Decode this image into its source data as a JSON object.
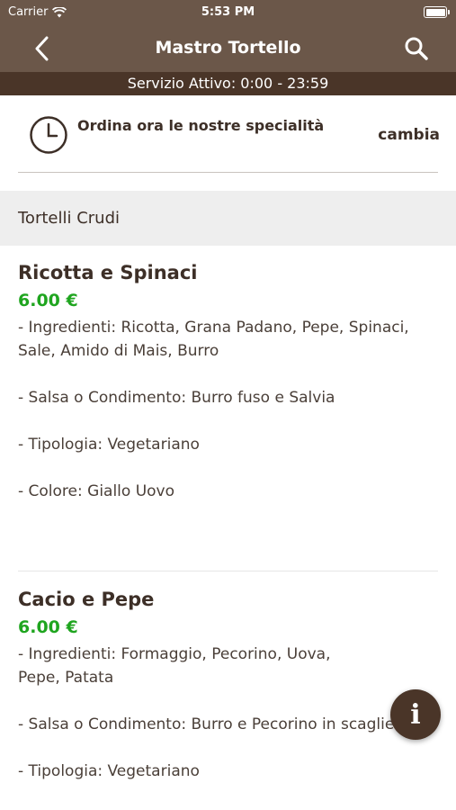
{
  "status_bar": {
    "carrier": "Carrier",
    "time": "5:53 PM"
  },
  "nav": {
    "title": "Mastro Tortello",
    "back_icon": "chevron-left-icon",
    "search_icon": "search-icon"
  },
  "service": {
    "text": "Servizio Attivo: 0:00 - 23:59"
  },
  "order": {
    "icon": "clock-icon",
    "text": "Ordina ora le nostre specialità",
    "change_label": "cambia"
  },
  "category": {
    "name": "Tortelli Crudi"
  },
  "products": [
    {
      "name": "Ricotta e Spinaci",
      "price": "6.00 €",
      "ingredients": "- Ingredienti: Ricotta, Grana Padano, Pepe, Spinaci, Sale, Amido di Mais, Burro",
      "sauce": "- Salsa o Condimento: Burro fuso e Salvia",
      "type": "- Tipologia: Vegetariano",
      "color": "- Colore: Giallo Uovo"
    },
    {
      "name": "Cacio e Pepe",
      "price": "6.00 €",
      "ingredients": "- Ingredienti: Formaggio, Pecorino, Uova, Pepe, Patata",
      "sauce": "- Salsa o Condimento: Burro e Pecorino in scaglie",
      "type": "- Tipologia: Vegetariano"
    }
  ],
  "fab": {
    "label": "i",
    "icon": "info-icon"
  },
  "colors": {
    "header": "#6b5749",
    "service_bar": "#4a3528",
    "price": "#1fa51f",
    "fab": "#4a3528"
  }
}
